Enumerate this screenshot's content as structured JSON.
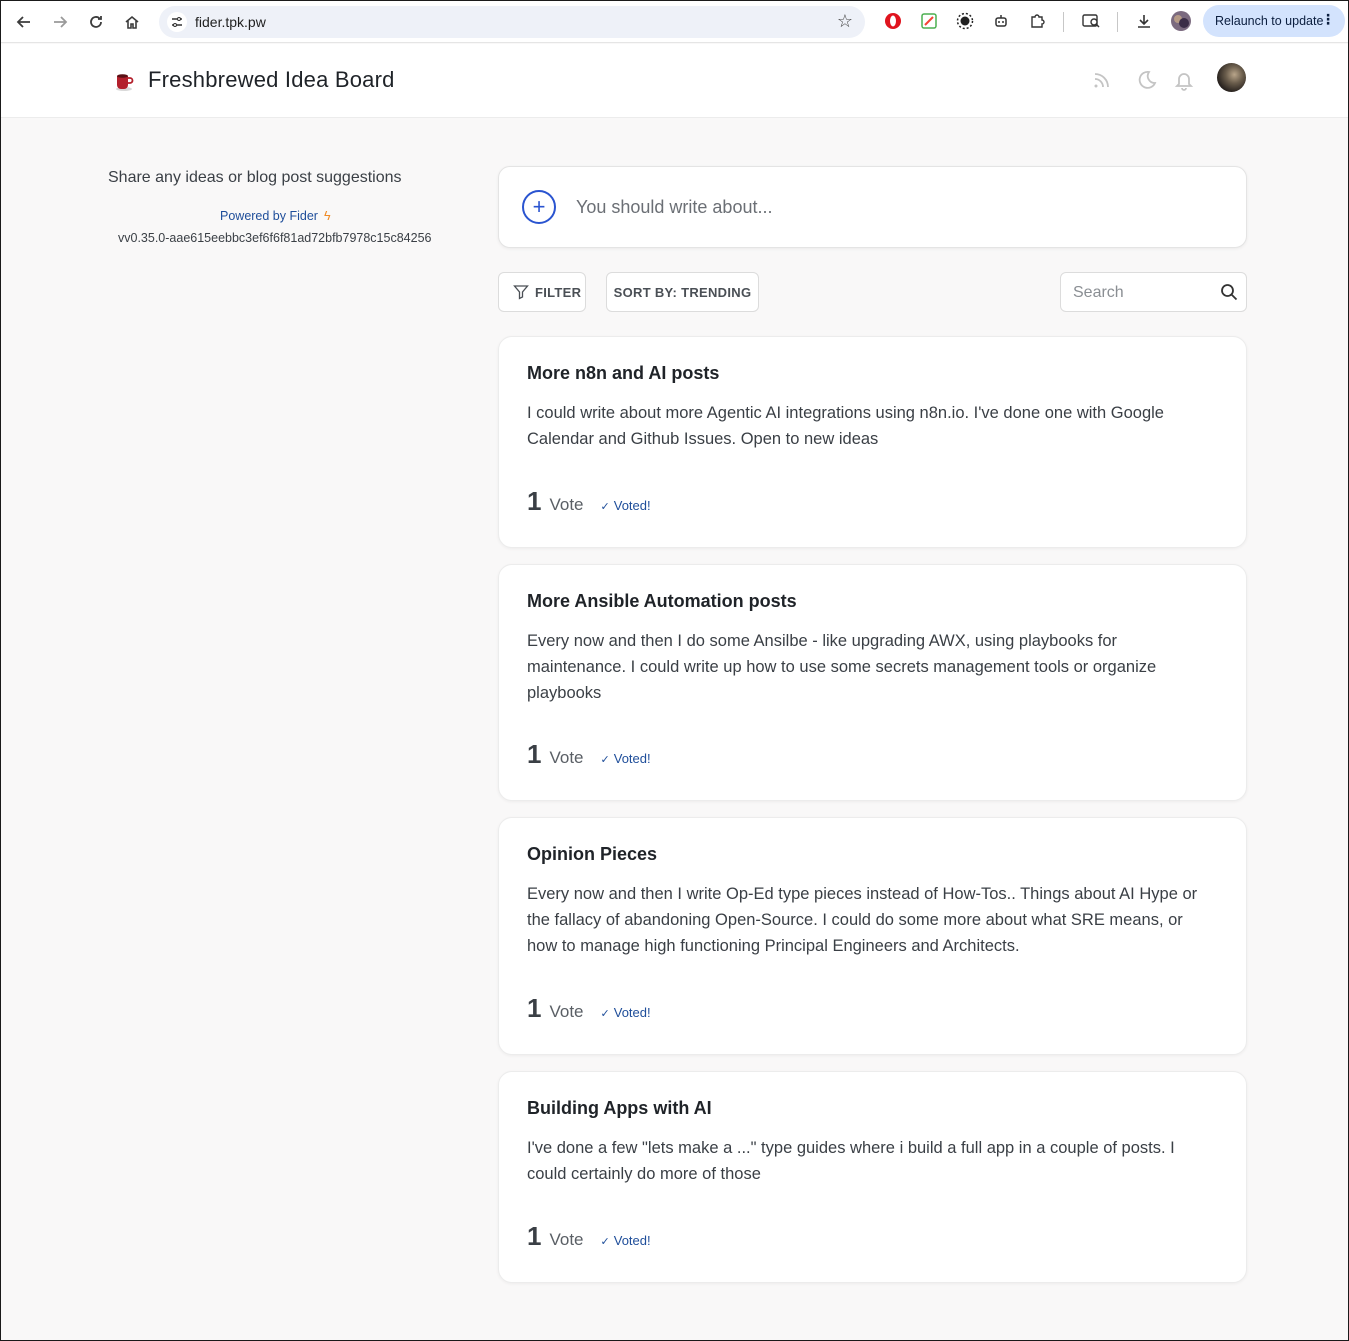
{
  "browser": {
    "url": "fider.tpk.pw",
    "relaunch_label": "Relaunch to update"
  },
  "header": {
    "site_title": "Freshbrewed Idea Board"
  },
  "sidebar": {
    "description": "Share any ideas or blog post suggestions",
    "powered_by": "Powered by Fider",
    "version": "vv0.35.0-aae615eebbc3ef6f6f81ad72bfb7978c15c84256"
  },
  "new_post": {
    "placeholder": "You should write about..."
  },
  "toolbar": {
    "filter_label": "FILTER",
    "sort_label": "SORT BY: TRENDING",
    "search_placeholder": "Search"
  },
  "posts": [
    {
      "title": "More n8n and AI posts",
      "description": "I could write about more Agentic AI integrations using n8n.io. I've done one with Google Calendar and Github Issues. Open to new ideas",
      "votes": "1",
      "vote_label": "Vote",
      "voted_label": "Voted!"
    },
    {
      "title": "More Ansible Automation posts",
      "description": "Every now and then I do some Ansilbe - like upgrading AWX, using playbooks for maintenance. I could write up how to use some secrets management tools or organize playbooks",
      "votes": "1",
      "vote_label": "Vote",
      "voted_label": "Voted!"
    },
    {
      "title": "Opinion Pieces",
      "description": "Every now and then I write Op-Ed type pieces instead of How-Tos.. Things about AI Hype or the fallacy of abandoning Open-Source. I could do some more about what SRE means, or how to manage high functioning Principal Engineers and Architects.",
      "votes": "1",
      "vote_label": "Vote",
      "voted_label": "Voted!"
    },
    {
      "title": "Building Apps with AI",
      "description": "I've done a few \"lets make a ...\" type guides where i build a full app in a couple of posts. I could certainly do more of those",
      "votes": "1",
      "vote_label": "Vote",
      "voted_label": "Voted!"
    }
  ],
  "colors": {
    "accent": "#2a54d0",
    "link": "#1f4e9a",
    "background": "#f9f8f8"
  }
}
